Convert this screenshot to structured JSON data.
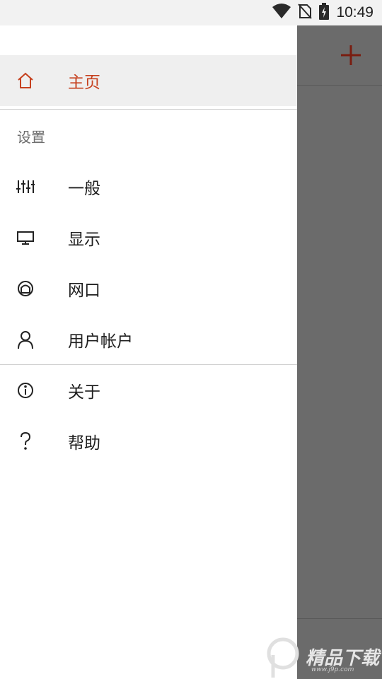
{
  "status_bar": {
    "time": "10:49",
    "icons": [
      "wifi-icon",
      "no-sim-icon",
      "battery-charging-icon"
    ]
  },
  "background": {
    "add_button_icon": "plus-icon",
    "accent": "#c6411f"
  },
  "drawer": {
    "home": {
      "label": "主页",
      "icon": "home-icon",
      "selected": true
    },
    "settings_header": "设置",
    "settings_items": [
      {
        "label": "一般",
        "icon": "sliders-icon"
      },
      {
        "label": "显示",
        "icon": "monitor-icon"
      },
      {
        "label": "网口",
        "icon": "network-port-icon"
      },
      {
        "label": "用户帐户",
        "icon": "user-icon"
      }
    ],
    "other_items": [
      {
        "label": "关于",
        "icon": "info-icon"
      },
      {
        "label": "帮助",
        "icon": "question-icon"
      }
    ]
  },
  "watermark": {
    "text": "精品下载",
    "url": "www.j9p.com"
  }
}
